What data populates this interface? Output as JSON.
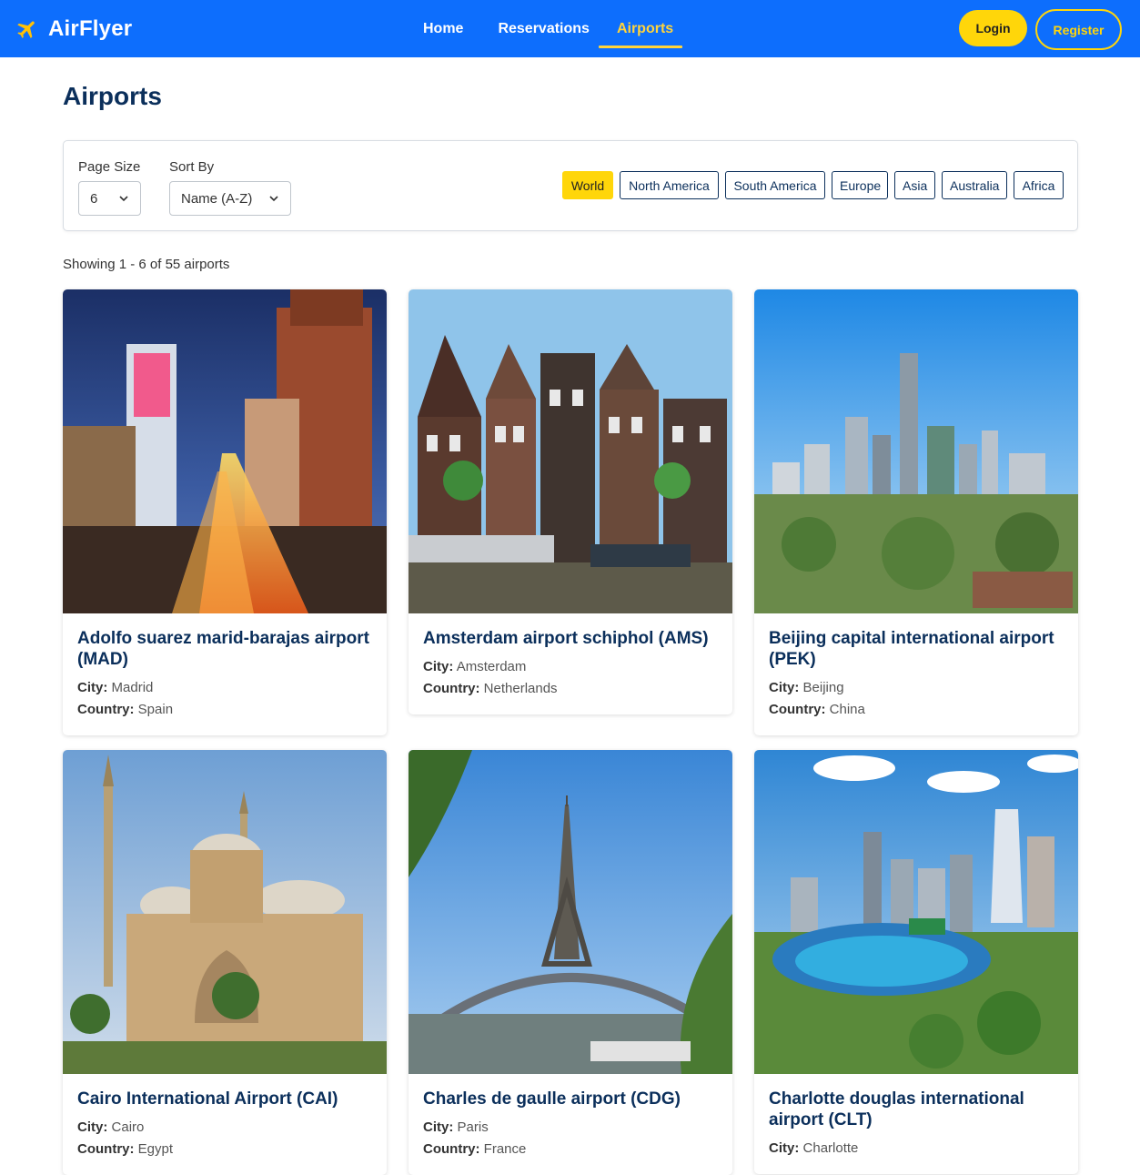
{
  "brand": {
    "name": "AirFlyer",
    "icon": "airplane-icon"
  },
  "nav": {
    "links": [
      "Home",
      "Reservations",
      "Airports"
    ],
    "active": "Airports",
    "login": "Login",
    "register": "Register"
  },
  "colors": {
    "primary": "#0d6efd",
    "accent": "#ffd60a",
    "title": "#0b2f5b"
  },
  "page": {
    "title": "Airports"
  },
  "filters": {
    "page_size_label": "Page Size",
    "page_size_value": "6",
    "sort_label": "Sort By",
    "sort_value": "Name (A-Z)",
    "regions": [
      "World",
      "North America",
      "South America",
      "Europe",
      "Asia",
      "Australia",
      "Africa"
    ],
    "active_region": "World"
  },
  "showing": "Showing 1 - 6 of 55 airports",
  "labels": {
    "city": "City:",
    "country": "Country:"
  },
  "airports": [
    {
      "name": "Adolfo suarez marid-barajas airport (MAD)",
      "city": "Madrid",
      "country": "Spain"
    },
    {
      "name": "Amsterdam airport schiphol (AMS)",
      "city": "Amsterdam",
      "country": "Netherlands"
    },
    {
      "name": "Beijing capital international airport (PEK)",
      "city": "Beijing",
      "country": "China"
    },
    {
      "name": "Cairo International Airport (CAI)",
      "city": "Cairo",
      "country": "Egypt"
    },
    {
      "name": "Charles de gaulle airport (CDG)",
      "city": "Paris",
      "country": "France"
    },
    {
      "name": "Charlotte douglas international airport (CLT)",
      "city": "Charlotte",
      "country": ""
    }
  ]
}
